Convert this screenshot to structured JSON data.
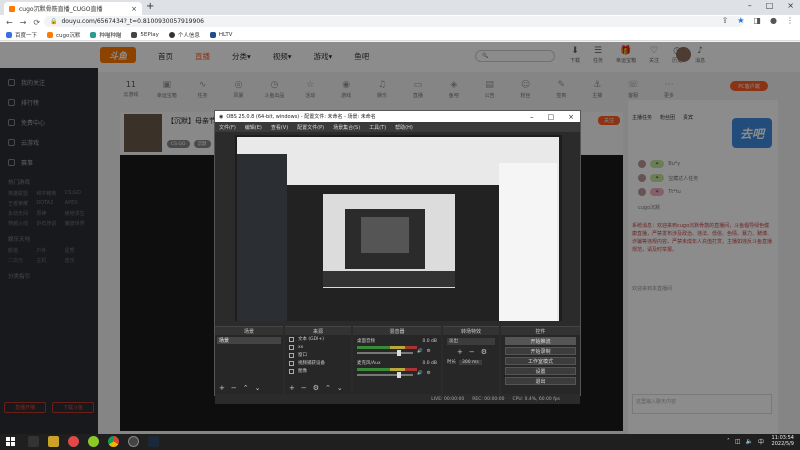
{
  "browser": {
    "tab_title": "cugo沉默骨筋直播_CUGO直播",
    "url": "douyu.com/6567434?_t=0.8100930057919906",
    "bookmarks": [
      "百度一下",
      "cugo沉默",
      "种喵种瞄",
      "5EPlay",
      "个人信息",
      "HLTV"
    ]
  },
  "site": {
    "logo": "斗鱼",
    "nav": [
      "首页",
      "直播",
      "分类▾",
      "视频▾",
      "游戏▾",
      "鱼吧"
    ],
    "header_icons": [
      "下载",
      "任务",
      "幸运宝箱",
      "关注",
      "历史",
      "消息"
    ],
    "sidebar": {
      "items": [
        "我的关注",
        "排行榜",
        "免费中心",
        "云游戏",
        "赛事"
      ],
      "sec1": "热门游戏",
      "sec2": "娱乐天地",
      "sec3": "分类指引",
      "grid1": [
        "英雄联盟",
        "和平精英",
        "CS:GO",
        "王者荣耀",
        "DOTA2",
        "APEX",
        "永劫无间",
        "原神",
        "绝地求生",
        "穿越火线",
        "炉石传说",
        "魔兽世界"
      ],
      "grid2": [
        "颜值",
        "户外",
        "星秀",
        "二次元",
        "主机",
        "音乐"
      ],
      "btn_left": "直播开播",
      "btn_right": "下载斗鱼"
    },
    "stats": {
      "num": "11",
      "labels": [
        "云游戏",
        "幸运宝箱",
        "任务",
        "风暴",
        "斗鱼出品",
        "活动",
        "游戏",
        "娱乐",
        "直播",
        "鱼吧",
        "公告",
        "粉丝",
        "签到",
        "主播",
        "客服",
        "更多",
        "视频",
        "更多"
      ]
    },
    "streamer": {
      "title": "【沉默】母亲节快乐",
      "tags": [
        "CS:GO",
        "沉默"
      ],
      "follow": "关注"
    },
    "right": {
      "pc_btn": "PC客户端",
      "tabs": [
        "主播任务",
        "粉丝团",
        "贵宾"
      ],
      "promo": "去吧",
      "rows": [
        "Bu*y",
        "宝藏达人任务",
        "Tt*tu",
        "cugo沉默"
      ],
      "chat": "系统消息：欢迎来到cugo沉默骨筋的直播间，斗鱼倡导绿色健康直播，严禁发布涉及政治、违法、低俗、色情、暴力、赌博、诈骗等违规内容。严禁未成年人充值打赏，主播如违反斗鱼直播规范，请及时举报。",
      "chat2": "欢迎来到本直播间",
      "input_placeholder": "这里输入聊天内容"
    }
  },
  "obs": {
    "title": "OBS 25.0.8 (64-bit, windows) - 配置文件: 未命名 - 场景: 未命名",
    "menu": [
      "文件(F)",
      "编辑(E)",
      "查看(V)",
      "配置文件(P)",
      "场景集合(S)",
      "工具(T)",
      "帮助(H)"
    ],
    "docks": {
      "scenes": "场景",
      "sources": "来源",
      "mixer": "混音器",
      "transitions": "转场特效",
      "controls": "控件"
    },
    "scene_items": [
      "场景"
    ],
    "source_items": [
      "文本 (GDI+)",
      "xx",
      "窗口",
      "视频捕获设备",
      "图像"
    ],
    "mixer_items": [
      {
        "name": "桌面音频",
        "db": "0.0 dB"
      },
      {
        "name": "麦克风/Aux",
        "db": "0.0 dB"
      }
    ],
    "transition": {
      "type": "淡出",
      "duration_label": "时长",
      "duration": "300 ms"
    },
    "controls": [
      "开始推流",
      "开始录制",
      "工作室模式",
      "设置",
      "退出"
    ],
    "status": [
      "LIVE: 00:00:00",
      "REC: 00:00:00",
      "CPU: 0.4%, 60.00 fps"
    ]
  },
  "taskbar": {
    "time": "11:03:54",
    "date": "2022/5/9"
  }
}
